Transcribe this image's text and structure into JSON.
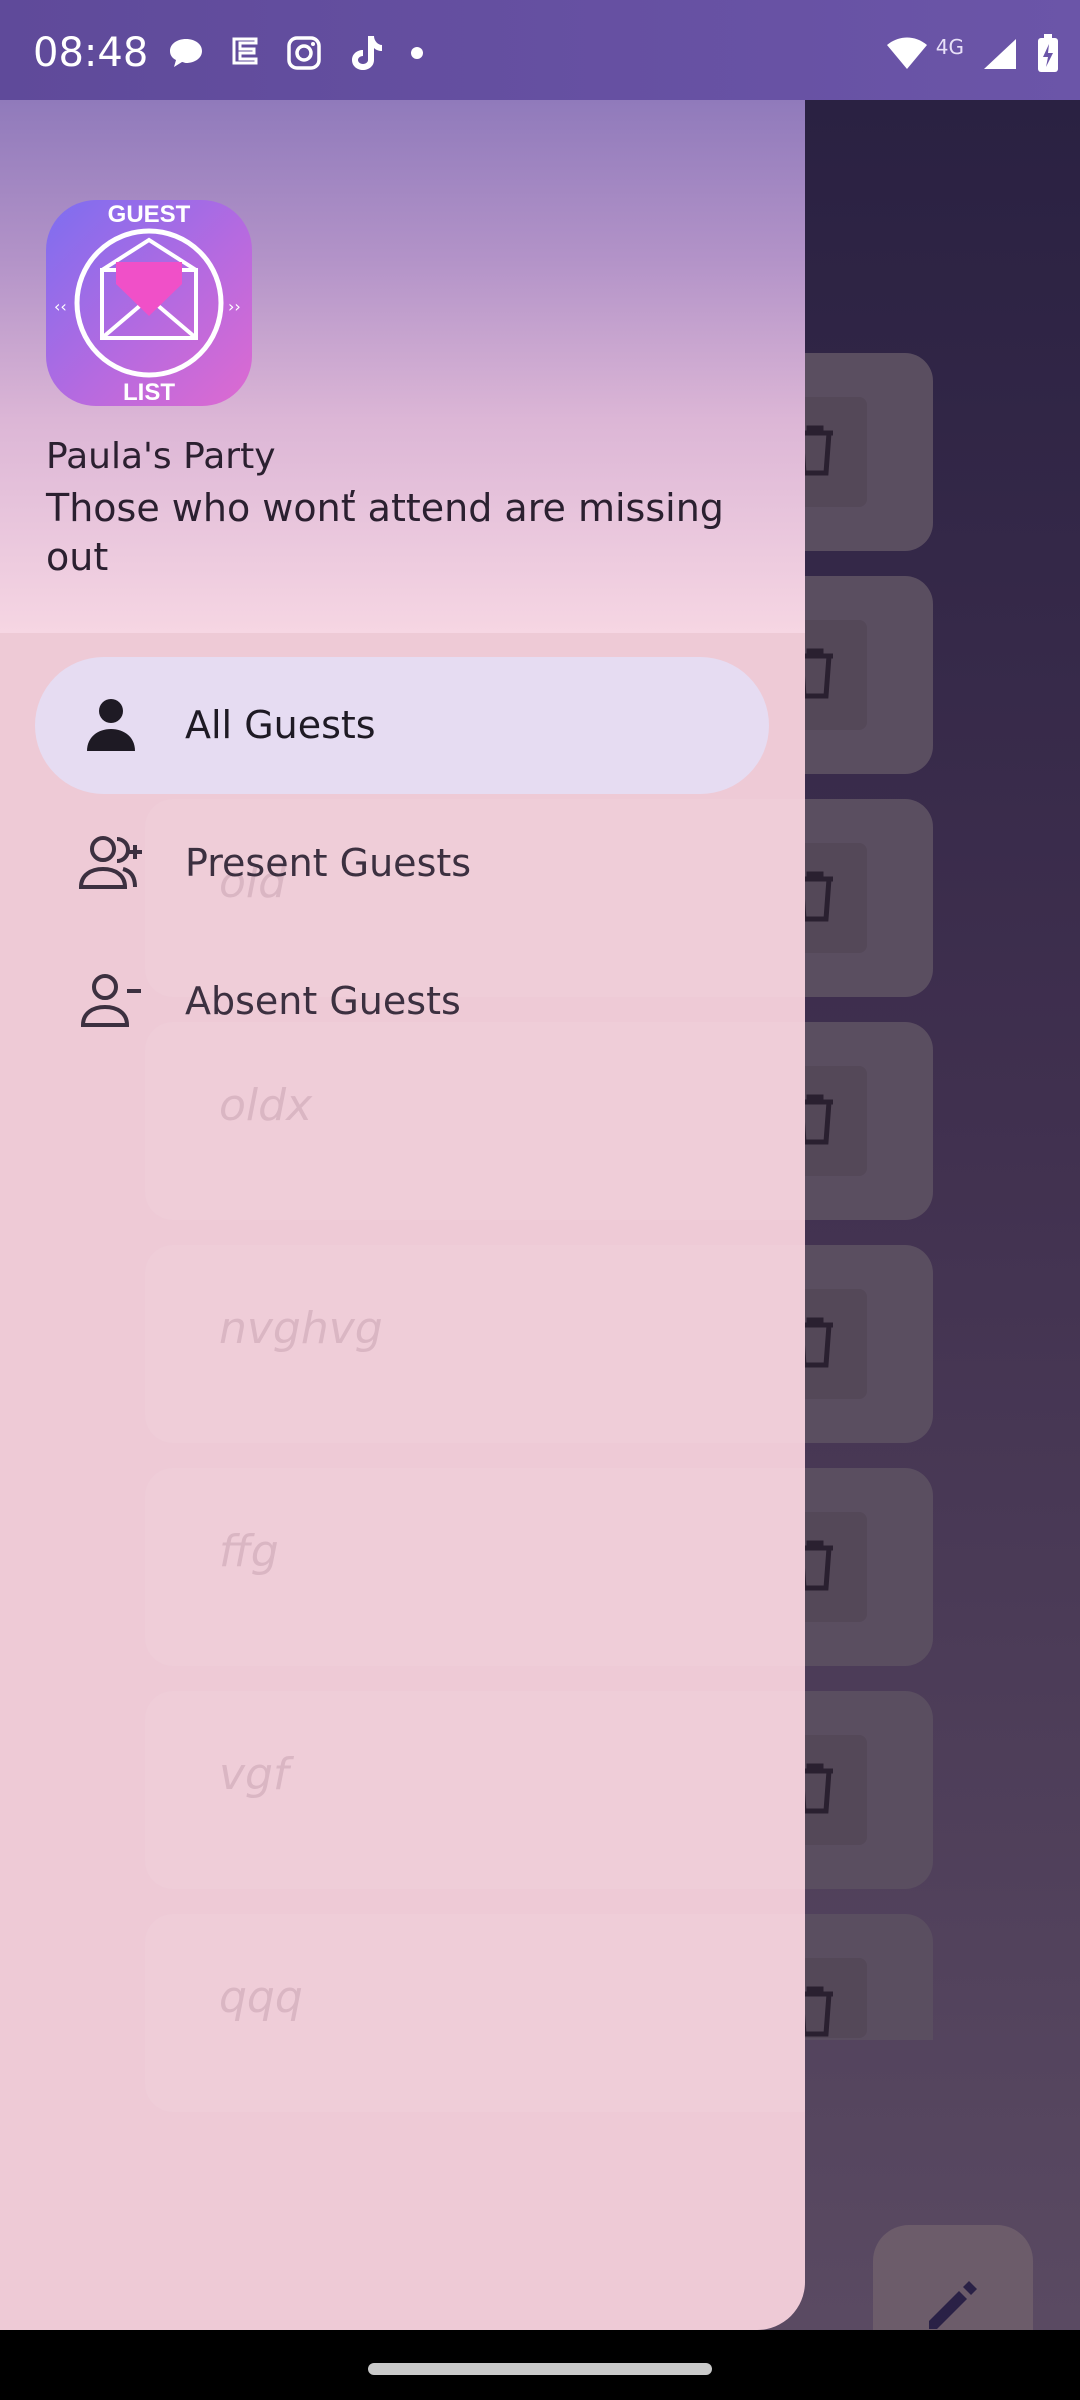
{
  "status_bar": {
    "time": "08:48",
    "network": "4G",
    "icons_left": [
      "message-bubble-icon",
      "mask-icon",
      "instagram-icon",
      "tiktok-icon",
      "dot-icon"
    ],
    "icons_right": [
      "wifi-icon",
      "signal-icon",
      "battery-charging-icon"
    ]
  },
  "drawer": {
    "header": {
      "title": "Paula's Party",
      "subtitle": "Those who wonť attend are missing out",
      "logo": {
        "top_text": "GUEST",
        "bottom_text": "LIST"
      }
    },
    "items": [
      {
        "label": "All Guests",
        "icon": "person-icon",
        "active": true
      },
      {
        "label": "Present Guests",
        "icon": "person-add-icon",
        "active": false
      },
      {
        "label": "Absent Guests",
        "icon": "person-remove-icon",
        "active": false
      }
    ]
  },
  "guest_list": [
    "old",
    "oldx",
    "nvghvg",
    "ffg",
    "vgf",
    "qqq"
  ],
  "colors": {
    "status_bar": "#6b55a8",
    "drawer_bg": "#eecad6",
    "active_item_bg": "#e6dcf2",
    "scrim_bg": "#3a2c4f"
  }
}
